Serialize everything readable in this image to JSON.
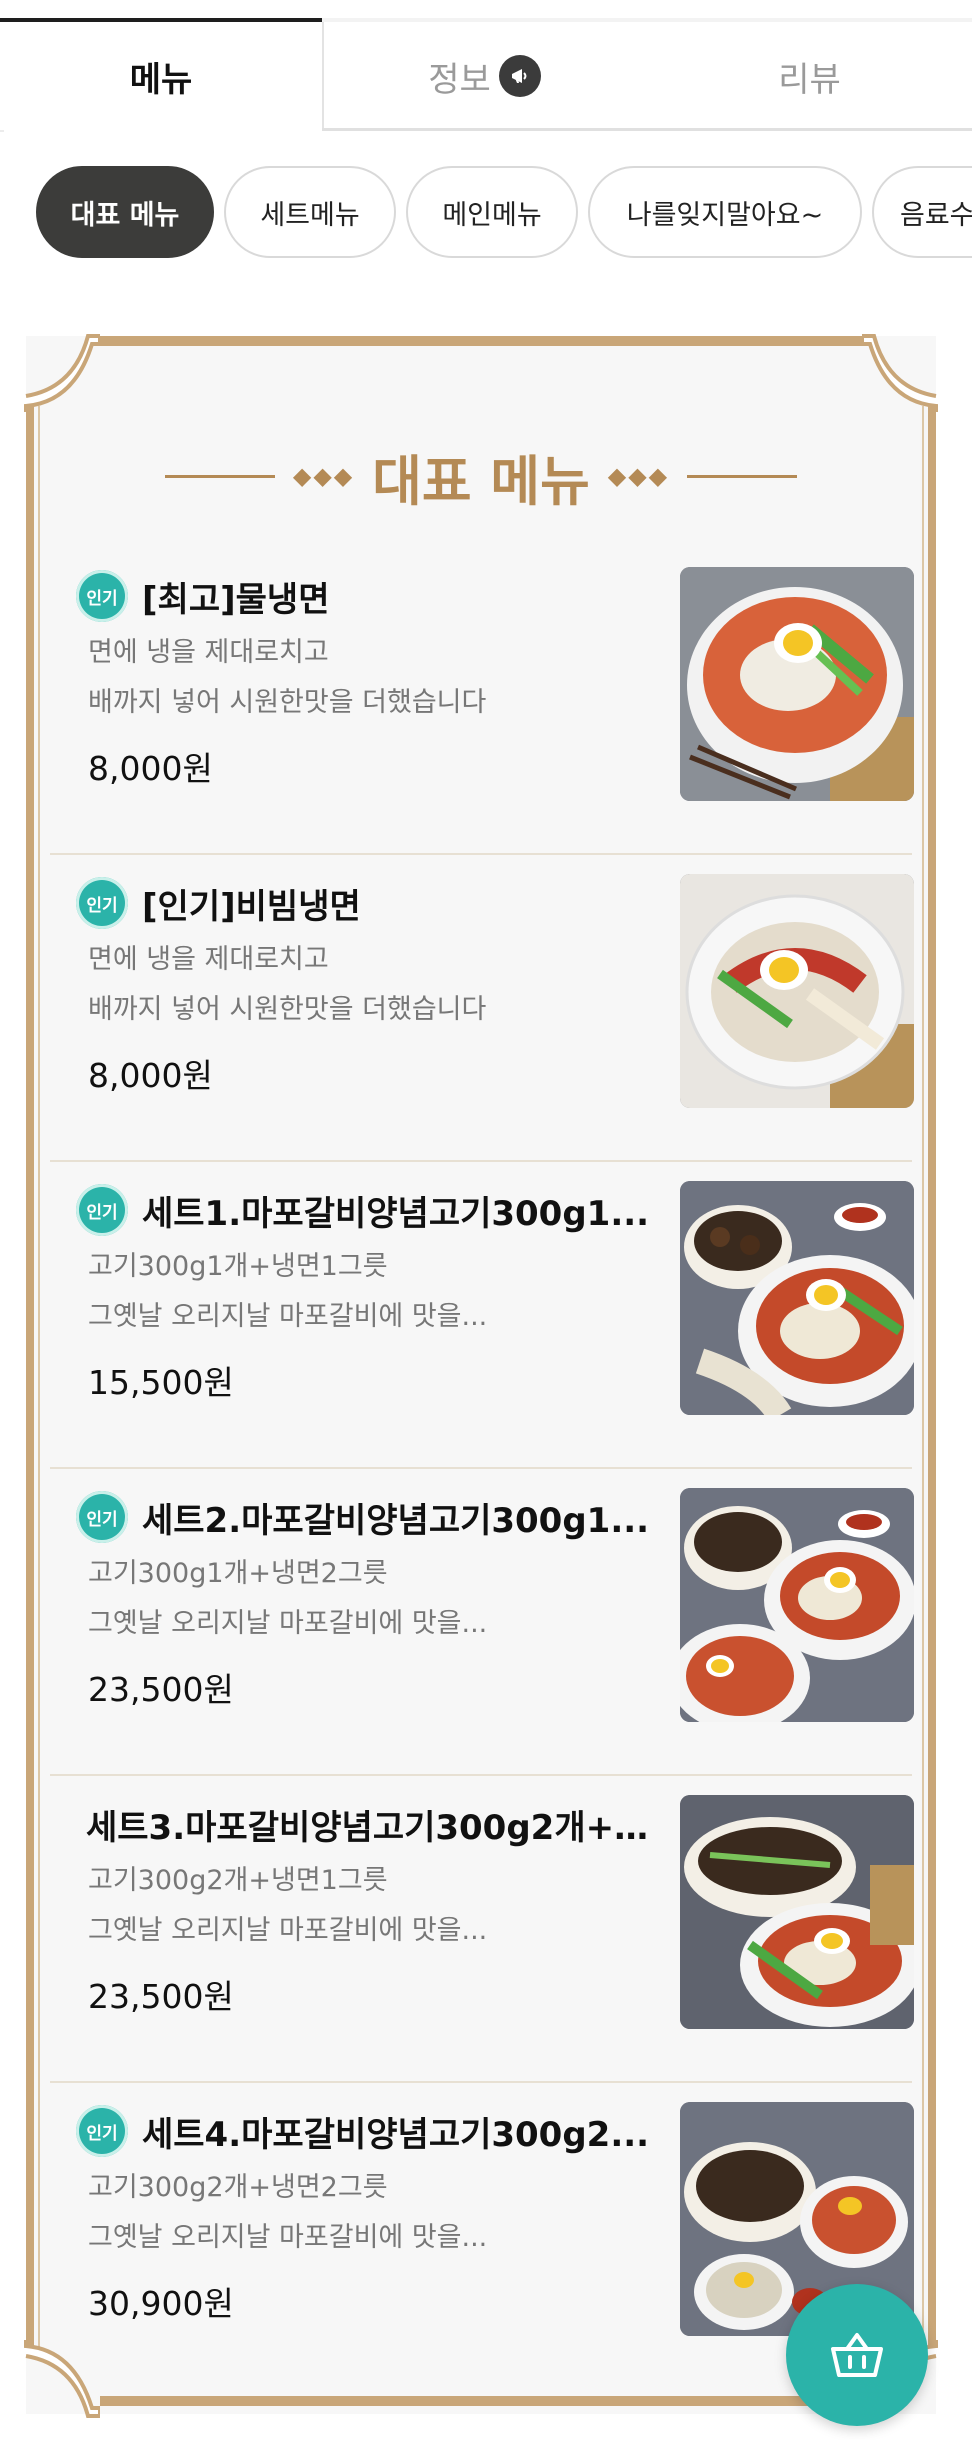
{
  "tabs": [
    {
      "label": "메뉴",
      "active": true
    },
    {
      "label": "정보",
      "icon": "megaphone-icon"
    },
    {
      "label": "리뷰"
    }
  ],
  "chips": [
    {
      "label": "대표 메뉴",
      "active": true
    },
    {
      "label": "세트메뉴"
    },
    {
      "label": "메인메뉴"
    },
    {
      "label": "나를잊지말아요~"
    },
    {
      "label": "음료수"
    }
  ],
  "section": {
    "title": "대표 메뉴",
    "accent_color": "#b48a55"
  },
  "menu_items": [
    {
      "badge": "인기",
      "name": "[최고]물냉면",
      "desc1": "면에 냉을 제대로치고",
      "desc2": "배까지 넣어 시원한맛을 더했습니다",
      "price": "8,000원"
    },
    {
      "badge": "인기",
      "name": "[인기]비빔냉면",
      "desc1": "면에 냉을 제대로치고",
      "desc2": "배까지 넣어 시원한맛을 더했습니다",
      "price": "8,000원"
    },
    {
      "badge": "인기",
      "name": "세트1.마포갈비양념고기300g1...",
      "desc1": "고기300g1개+냉면1그릇",
      "desc2": "그옛날 오리지날 마포갈비에 맛을...",
      "price": "15,500원"
    },
    {
      "badge": "인기",
      "name": "세트2.마포갈비양념고기300g1...",
      "desc1": "고기300g1개+냉면2그릇",
      "desc2": "그옛날 오리지날 마포갈비에 맛을...",
      "price": "23,500원"
    },
    {
      "badge": "",
      "name": "세트3.마포갈비양념고기300g2개+...",
      "desc1": "고기300g2개+냉면1그릇",
      "desc2": "그옛날 오리지날 마포갈비에 맛을...",
      "price": "23,500원"
    },
    {
      "badge": "인기",
      "name": "세트4.마포갈비양념고기300g2...",
      "desc1": "고기300g2개+냉면2그릇",
      "desc2": "그옛날 오리지날 마포갈비에 맛을...",
      "price": "30,900원"
    }
  ],
  "cart": {
    "icon": "basket-icon",
    "color": "#2bb3a9"
  },
  "colors": {
    "badge": "#2bb3a9",
    "frame": "#c9a678",
    "chip_active": "#3c3c3a"
  }
}
